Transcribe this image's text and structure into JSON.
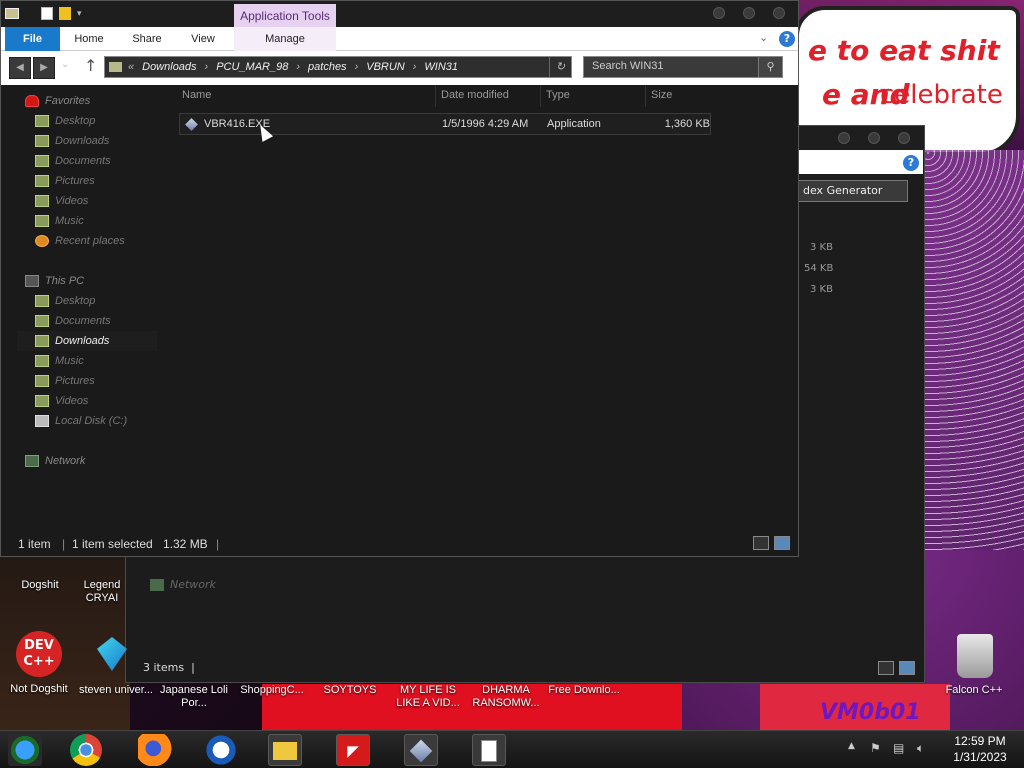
{
  "wallpaper": {
    "line1": "e to eat shit",
    "line2a": "e and",
    "line2b": "celebrate",
    "corner": "VM0b01"
  },
  "back_window": {
    "address_tail": "dex Generator",
    "sizes": [
      "3 KB",
      "54 KB",
      "3 KB"
    ],
    "network_label": "Network",
    "status": "3 items"
  },
  "front_window": {
    "app_tools": "Application Tools",
    "tabs": {
      "file": "File",
      "home": "Home",
      "share": "Share",
      "view": "View",
      "manage": "Manage"
    },
    "address": {
      "prefix": "«",
      "crumbs": [
        "Downloads",
        "PCU_MAR_98",
        "patches",
        "VBRUN",
        "WIN31"
      ]
    },
    "search_placeholder": "Search WIN31",
    "nav": {
      "favorites": "Favorites",
      "fav_items": [
        "Desktop",
        "Downloads",
        "Documents",
        "Pictures",
        "Videos",
        "Music",
        "Recent places"
      ],
      "thispc": "This PC",
      "pc_items": [
        "Desktop",
        "Documents",
        "Downloads",
        "Music",
        "Pictures",
        "Videos",
        "Local Disk (C:)"
      ],
      "network": "Network"
    },
    "columns": {
      "name": "Name",
      "date": "Date modified",
      "type": "Type",
      "size": "Size"
    },
    "file": {
      "name": "VBR416.EXE",
      "date": "1/5/1996 4:29 AM",
      "type": "Application",
      "size": "1,360 KB"
    },
    "status": {
      "count": "1 item",
      "selected": "1 item selected",
      "size": "1.32 MB"
    }
  },
  "desktop_icons": [
    {
      "label": "Dogshit"
    },
    {
      "label": "Legend CRYAI"
    },
    {
      "label": "Not Dogshit"
    },
    {
      "label": "steven univer..."
    },
    {
      "label": "Japanese Loli Por..."
    },
    {
      "label": "ShoppingC..."
    },
    {
      "label": "SOYTOYS"
    },
    {
      "label": "MY LIFE IS LIKE A VID..."
    },
    {
      "label": "DHARMA RANSOMW..."
    },
    {
      "label": "Free Downlo..."
    },
    {
      "label": "Falcon C++"
    }
  ],
  "devcpp_text": "DEV C++",
  "clock": {
    "time": "12:59 PM",
    "date": "1/31/2023"
  },
  "colors": {
    "file_tab": "#1979ca",
    "app_tools": "#e6d2f0",
    "window_bg": "#1a1a1a"
  }
}
